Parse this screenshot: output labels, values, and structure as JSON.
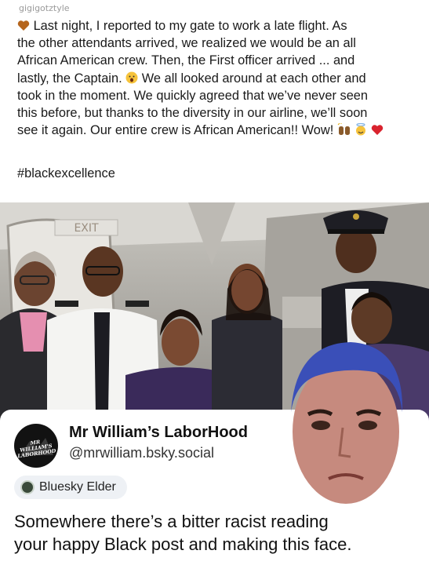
{
  "watermark": "gigigotztyle",
  "post": {
    "line1": "Last night, I reported to my gate to work a late flight. As",
    "line2": "the other attendants arrived, we realized we would be an all",
    "line3": "African American crew. Then, the First officer arrived ... and",
    "line4a": "lastly, the Captain.",
    "line4b": "We all looked around at each other and",
    "line5": "took in the moment. We quickly agreed that we’ve never seen",
    "line6": "this before, but thanks to the diversity in our airline, we’ll soon",
    "line7": "see it again. Our entire crew is African American!! Wow!",
    "hashtag": "#blackexcellence"
  },
  "photo": {
    "exit_sign": "EXIT"
  },
  "card": {
    "avatar_text": "MR WILLIAM'S LABORHOOD",
    "display_name": "Mr William’s LaborHood",
    "handle": "@mrwilliam.bsky.social",
    "badge_label": "Bluesky Elder",
    "caption_line1": "Somewhere there’s a bitter racist reading",
    "caption_line2": "your happy Black post and making this face."
  },
  "colors": {
    "heart_brown": "#b5651d",
    "heart_red": "#d9232e",
    "badge_bg": "#eef1f5"
  },
  "icons": [
    "brown-heart-icon",
    "shocked-face-icon",
    "raised-hands-icon",
    "halo-smile-icon",
    "red-heart-icon",
    "bluesky-elder-badge-icon"
  ]
}
